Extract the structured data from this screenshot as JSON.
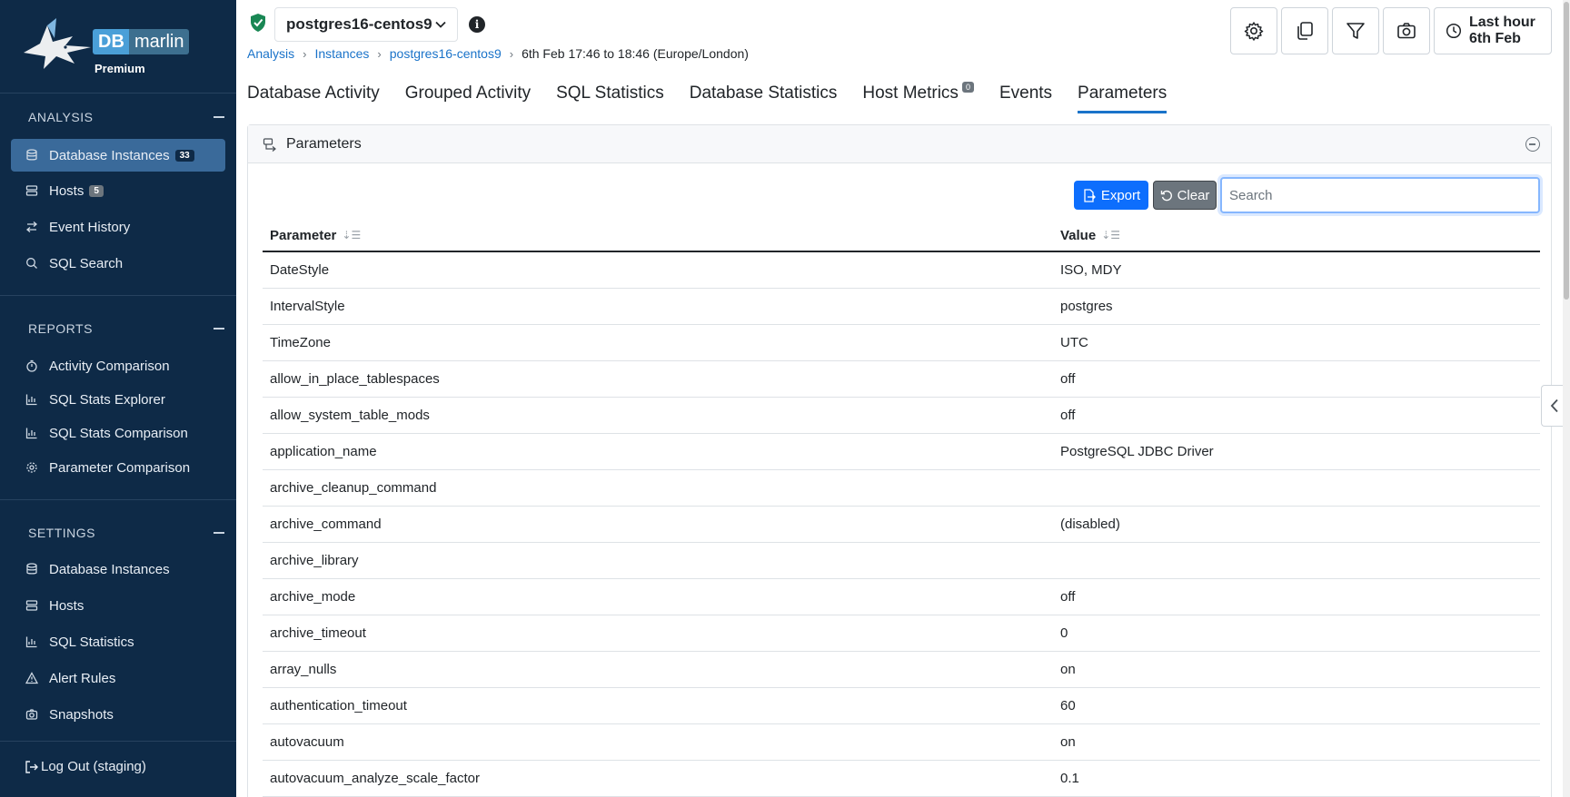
{
  "brand": {
    "logo_db": "DB",
    "logo_marlin": "marlin",
    "tier": "Premium"
  },
  "sidebar": {
    "analysis": {
      "title": "ANALYSIS",
      "items": [
        {
          "label": "Database Instances",
          "badge": "33",
          "icon": "database-icon"
        },
        {
          "label": "Hosts",
          "badge": "5",
          "icon": "server-icon"
        },
        {
          "label": "Event History",
          "icon": "arrows-exchange-icon"
        },
        {
          "label": "SQL Search",
          "icon": "search-icon"
        }
      ]
    },
    "reports": {
      "title": "REPORTS",
      "items": [
        {
          "label": "Activity Comparison",
          "icon": "stopwatch-icon"
        },
        {
          "label": "SQL Stats Explorer",
          "icon": "bar-chart-icon"
        },
        {
          "label": "SQL Stats Comparison",
          "icon": "bar-chart-icon"
        },
        {
          "label": "Parameter Comparison",
          "icon": "gear-icon"
        }
      ]
    },
    "settings": {
      "title": "SETTINGS",
      "items": [
        {
          "label": "Database Instances",
          "icon": "database-icon"
        },
        {
          "label": "Hosts",
          "icon": "server-icon"
        },
        {
          "label": "SQL Statistics",
          "icon": "bar-chart-icon"
        },
        {
          "label": "Alert Rules",
          "icon": "warning-icon"
        },
        {
          "label": "Snapshots",
          "icon": "camera-icon"
        }
      ]
    },
    "logout_label": "Log Out (staging)"
  },
  "header": {
    "instance_name": "postgres16-centos9",
    "breadcrumb": {
      "analysis": "Analysis",
      "instances": "Instances",
      "instance": "postgres16-centos9",
      "range": "6th Feb 17:46 to 18:46 (Europe/London)"
    },
    "time": {
      "line1": "Last hour",
      "line2": "6th Feb"
    }
  },
  "tabs": [
    {
      "label": "Database Activity"
    },
    {
      "label": "Grouped Activity"
    },
    {
      "label": "SQL Statistics"
    },
    {
      "label": "Database Statistics"
    },
    {
      "label": "Host Metrics",
      "badge": "0"
    },
    {
      "label": "Events"
    },
    {
      "label": "Parameters",
      "active": true
    }
  ],
  "panel": {
    "title": "Parameters",
    "export_label": "Export",
    "clear_label": "Clear",
    "search_placeholder": "Search",
    "search_value": "",
    "columns": [
      "Parameter",
      "Value"
    ],
    "rows": [
      [
        "DateStyle",
        "ISO, MDY"
      ],
      [
        "IntervalStyle",
        "postgres"
      ],
      [
        "TimeZone",
        "UTC"
      ],
      [
        "allow_in_place_tablespaces",
        "off"
      ],
      [
        "allow_system_table_mods",
        "off"
      ],
      [
        "application_name",
        "PostgreSQL JDBC Driver"
      ],
      [
        "archive_cleanup_command",
        ""
      ],
      [
        "archive_command",
        "(disabled)"
      ],
      [
        "archive_library",
        ""
      ],
      [
        "archive_mode",
        "off"
      ],
      [
        "archive_timeout",
        "0"
      ],
      [
        "array_nulls",
        "on"
      ],
      [
        "authentication_timeout",
        "60"
      ],
      [
        "autovacuum",
        "on"
      ],
      [
        "autovacuum_analyze_scale_factor",
        "0.1"
      ]
    ]
  },
  "colors": {
    "sidebar_bg": "#0e2a47",
    "sidebar_active": "#3a6a9a",
    "link": "#1a73c9",
    "primary_button": "#0d6efd",
    "secondary_button": "#6c757d",
    "shield_green": "#198754"
  }
}
